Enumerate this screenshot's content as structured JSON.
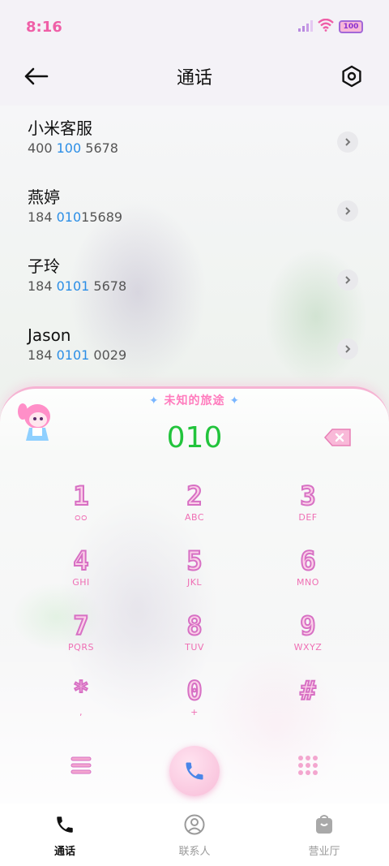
{
  "status_bar": {
    "time": "8:16",
    "battery": "100",
    "icons": [
      "signal-icon",
      "wifi-icon",
      "battery-icon"
    ]
  },
  "header": {
    "title": "通话",
    "back_icon": "back-arrow-icon",
    "settings_icon": "settings-icon"
  },
  "contacts": [
    {
      "name": "小米客服",
      "num_parts": [
        "400 ",
        "100",
        " 5678"
      ]
    },
    {
      "name": "燕婷",
      "num_parts": [
        "184 ",
        "010",
        "15689"
      ]
    },
    {
      "name": "子玲",
      "num_parts": [
        "184 ",
        "0101",
        " 5678"
      ]
    },
    {
      "name": "Jason",
      "num_parts": [
        "184 ",
        "0101",
        " 0029"
      ]
    }
  ],
  "dialer": {
    "banner_left_star": "✦",
    "banner_text": "未知的旅途",
    "banner_right_star": "✦",
    "number": "010",
    "keys": [
      {
        "digit": "1",
        "letters": "ᴑᴑ"
      },
      {
        "digit": "2",
        "letters": "ABC"
      },
      {
        "digit": "3",
        "letters": "DEF"
      },
      {
        "digit": "4",
        "letters": "GHI"
      },
      {
        "digit": "5",
        "letters": "JKL"
      },
      {
        "digit": "6",
        "letters": "MNO"
      },
      {
        "digit": "7",
        "letters": "PQRS"
      },
      {
        "digit": "8",
        "letters": "TUV"
      },
      {
        "digit": "9",
        "letters": "WXYZ"
      },
      {
        "digit": "*",
        "letters": ","
      },
      {
        "digit": "0",
        "letters": "+"
      },
      {
        "digit": "#",
        "letters": ""
      }
    ]
  },
  "nav": {
    "items": [
      {
        "label": "通话",
        "icon": "phone-icon",
        "active": true
      },
      {
        "label": "联系人",
        "icon": "contacts-icon",
        "active": false
      },
      {
        "label": "营业厅",
        "icon": "store-bag-icon",
        "active": false
      }
    ]
  },
  "colors": {
    "accent_pink": "#ef5fa7",
    "number_green": "#22c43c",
    "highlight_blue": "#2b8ee6"
  }
}
